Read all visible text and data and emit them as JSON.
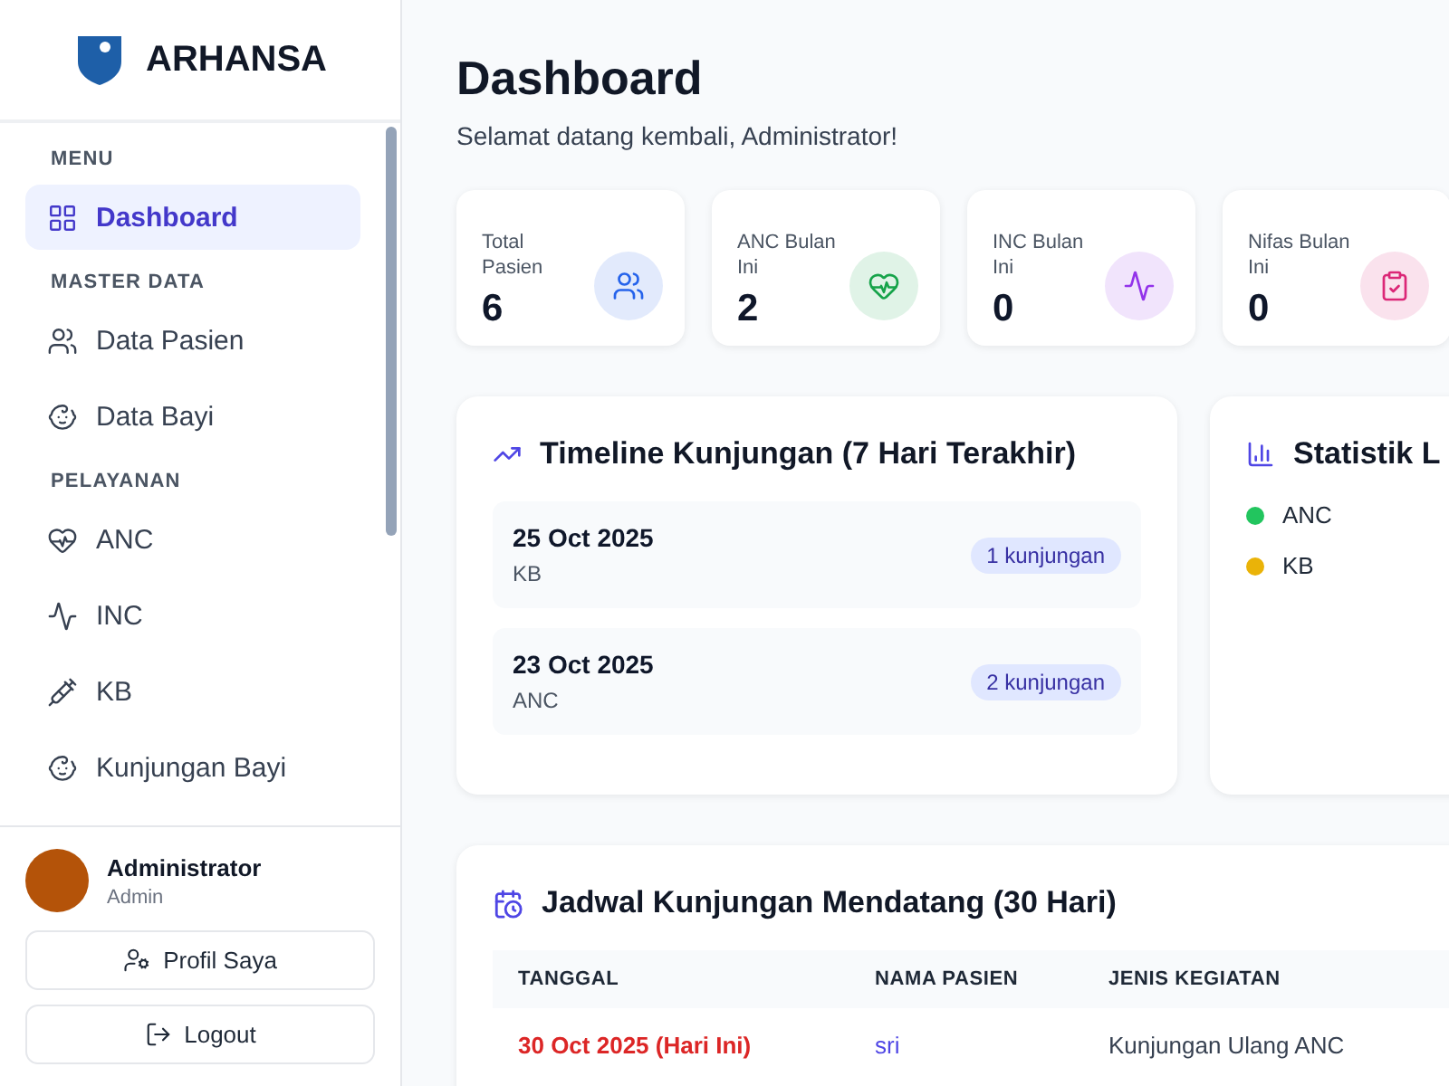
{
  "brand": {
    "name": "ARHANSA"
  },
  "sidebar": {
    "sections": [
      {
        "title": "MENU",
        "items": [
          {
            "label": "Dashboard",
            "selected": true
          }
        ]
      },
      {
        "title": "MASTER DATA",
        "items": [
          {
            "label": "Data Pasien",
            "selected": false
          },
          {
            "label": "Data Bayi",
            "selected": false
          }
        ]
      },
      {
        "title": "PELAYANAN",
        "items": [
          {
            "label": "ANC",
            "selected": false
          },
          {
            "label": "INC",
            "selected": false
          },
          {
            "label": "KB",
            "selected": false
          },
          {
            "label": "Kunjungan Bayi",
            "selected": false
          }
        ]
      }
    ],
    "user": {
      "name": "Administrator",
      "role": "Admin"
    },
    "buttons": [
      "Profil Saya",
      "Logout"
    ]
  },
  "header": {
    "title": "Dashboard",
    "subtitle": "Selamat datang kembali, Administrator!"
  },
  "stats": [
    {
      "label": "Total Pasien",
      "value": "6",
      "color": "#2563eb"
    },
    {
      "label": "ANC Bulan Ini",
      "value": "2",
      "color": "#16a34a"
    },
    {
      "label": "INC Bulan Ini",
      "value": "0",
      "color": "#9333ea"
    },
    {
      "label": "Nifas Bulan Ini",
      "value": "0",
      "color": "#db2777"
    }
  ],
  "timeline": {
    "title": "Timeline Kunjungan (7 Hari Terakhir)",
    "entries": [
      {
        "date": "25 Oct 2025",
        "type": "KB",
        "count": "1 kunjungan"
      },
      {
        "date": "23 Oct 2025",
        "type": "ANC",
        "count": "2 kunjungan"
      }
    ]
  },
  "statistics": {
    "title": "Statistik L",
    "legend": [
      {
        "label": "ANC",
        "color": "#22c55e"
      },
      {
        "label": "KB",
        "color": "#eab308"
      }
    ]
  },
  "schedule": {
    "title": "Jadwal Kunjungan Mendatang (30 Hari)",
    "columns": [
      "TANGGAL",
      "NAMA PASIEN",
      "JENIS KEGIATAN"
    ],
    "rows": [
      {
        "date": "30 Oct 2025 (Hari Ini)",
        "today": true,
        "patient": "sri",
        "activity": "Kunjungan Ulang ANC"
      }
    ]
  }
}
